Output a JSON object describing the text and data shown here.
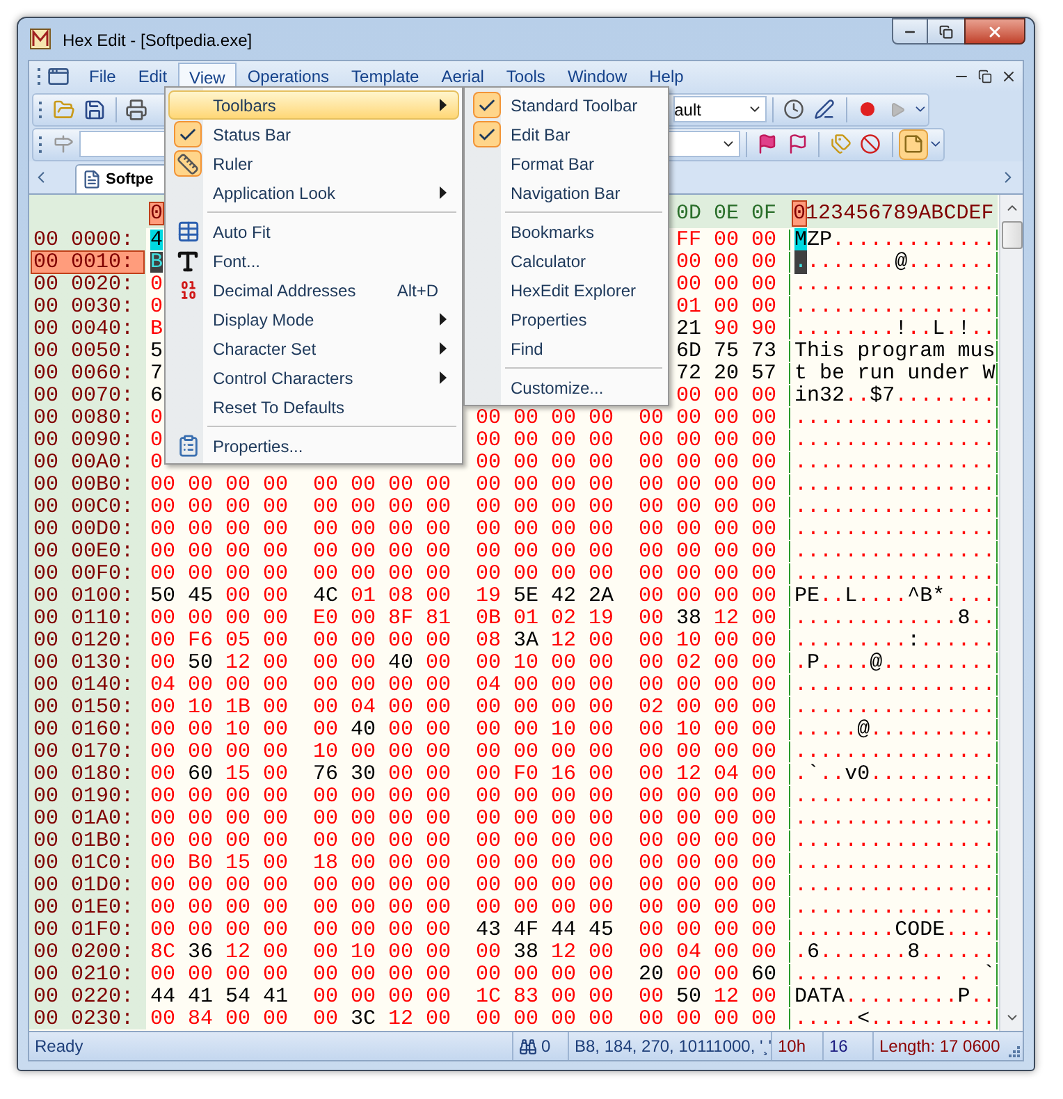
{
  "window": {
    "title": "Hex Edit - [Softpedia.exe]"
  },
  "menu_bar": [
    {
      "label": "File",
      "selected": false
    },
    {
      "label": "Edit",
      "selected": false
    },
    {
      "label": "View",
      "selected": true
    },
    {
      "label": "Operations",
      "selected": false
    },
    {
      "label": "Template",
      "selected": false
    },
    {
      "label": "Aerial",
      "selected": false
    },
    {
      "label": "Tools",
      "selected": false
    },
    {
      "label": "Window",
      "selected": false
    },
    {
      "label": "Help",
      "selected": false
    }
  ],
  "toolbar": {
    "combo_value": "ault"
  },
  "tabs": [
    {
      "label": "Softpe",
      "selected": true
    }
  ],
  "hex_view": {
    "header_lead": {
      "text": "0",
      "selected": true
    },
    "header_tail": [
      "0D",
      "0E",
      "0F"
    ],
    "text_header": "0123456789ABCDEF",
    "rows": [
      {
        "address": "00 0000:",
        "selected": false,
        "marked": true,
        "lead": "4",
        "lead_printable": true,
        "tail": [
          "FF",
          "00",
          "00"
        ],
        "text": "MZP............."
      },
      {
        "address": "00 0010:",
        "selected": true,
        "marked": false,
        "lead": "B",
        "lead_printable": false,
        "tail": [
          "00",
          "00",
          "00"
        ],
        "text": "........@......."
      },
      {
        "address": "00 0020:",
        "selected": false,
        "marked": false,
        "lead": "0",
        "lead_printable": false,
        "tail": [
          "00",
          "00",
          "00"
        ],
        "text": "................"
      },
      {
        "address": "00 0030:",
        "selected": false,
        "marked": false,
        "lead": "0",
        "lead_printable": false,
        "tail": [
          "01",
          "00",
          "00"
        ],
        "text": "................"
      },
      {
        "address": "00 0040:",
        "selected": false,
        "marked": false,
        "lead": "B",
        "lead_printable": false,
        "tail": [
          "21",
          "90",
          "90"
        ],
        "text": "........!..L.!.."
      },
      {
        "address": "00 0050:",
        "selected": false,
        "marked": false,
        "lead": "5",
        "lead_printable": true,
        "tail": [
          "6D",
          "75",
          "73"
        ],
        "text": "This program mus"
      },
      {
        "address": "00 0060:",
        "selected": false,
        "marked": false,
        "lead": "7",
        "lead_printable": true,
        "tail": [
          "72",
          "20",
          "57"
        ],
        "text": "t be run under W"
      },
      {
        "address": "00 0070:",
        "selected": false,
        "marked": false,
        "lead": "6",
        "lead_printable": true,
        "tail": [
          "00",
          "00",
          "00"
        ],
        "text": "in32..$7........"
      },
      {
        "address": "00 0080:",
        "selected": false,
        "marked": false,
        "lead": "0",
        "lead_printable": false,
        "tail": [
          "00",
          "00",
          "00",
          "00",
          "00",
          "00",
          "00",
          "00"
        ],
        "text": "................"
      },
      {
        "address": "00 0090:",
        "selected": false,
        "marked": false,
        "lead": "0",
        "lead_printable": false,
        "tail": [
          "00",
          "00",
          "00",
          "00",
          "00",
          "00",
          "00",
          "00"
        ],
        "text": "................"
      },
      {
        "address": "00 00A0:",
        "selected": false,
        "marked": false,
        "lead": "0",
        "lead_printable": false,
        "tail": [
          "00",
          "00",
          "00",
          "00",
          "00",
          "00",
          "00",
          "00"
        ],
        "text": "................"
      },
      {
        "address": "00 00B0:",
        "selected": false,
        "marked": false,
        "bytes": [
          "00",
          "00",
          "00",
          "00",
          "00",
          "00",
          "00",
          "00",
          "00",
          "00",
          "00",
          "00",
          "00",
          "00",
          "00",
          "00"
        ],
        "text": "................"
      },
      {
        "address": "00 00C0:",
        "selected": false,
        "marked": false,
        "bytes": [
          "00",
          "00",
          "00",
          "00",
          "00",
          "00",
          "00",
          "00",
          "00",
          "00",
          "00",
          "00",
          "00",
          "00",
          "00",
          "00"
        ],
        "text": "................"
      },
      {
        "address": "00 00D0:",
        "selected": false,
        "marked": false,
        "bytes": [
          "00",
          "00",
          "00",
          "00",
          "00",
          "00",
          "00",
          "00",
          "00",
          "00",
          "00",
          "00",
          "00",
          "00",
          "00",
          "00"
        ],
        "text": "................"
      },
      {
        "address": "00 00E0:",
        "selected": false,
        "marked": false,
        "bytes": [
          "00",
          "00",
          "00",
          "00",
          "00",
          "00",
          "00",
          "00",
          "00",
          "00",
          "00",
          "00",
          "00",
          "00",
          "00",
          "00"
        ],
        "text": "................"
      },
      {
        "address": "00 00F0:",
        "selected": false,
        "marked": false,
        "bytes": [
          "00",
          "00",
          "00",
          "00",
          "00",
          "00",
          "00",
          "00",
          "00",
          "00",
          "00",
          "00",
          "00",
          "00",
          "00",
          "00"
        ],
        "text": "................"
      },
      {
        "address": "00 0100:",
        "selected": false,
        "marked": false,
        "bytes": [
          "50",
          "45",
          "00",
          "00",
          "4C",
          "01",
          "08",
          "00",
          "19",
          "5E",
          "42",
          "2A",
          "00",
          "00",
          "00",
          "00"
        ],
        "text": "PE..L....^B*...."
      },
      {
        "address": "00 0110:",
        "selected": false,
        "marked": false,
        "bytes": [
          "00",
          "00",
          "00",
          "00",
          "E0",
          "00",
          "8F",
          "81",
          "0B",
          "01",
          "02",
          "19",
          "00",
          "38",
          "12",
          "00"
        ],
        "text": ".............8.."
      },
      {
        "address": "00 0120:",
        "selected": false,
        "marked": false,
        "bytes": [
          "00",
          "F6",
          "05",
          "00",
          "00",
          "00",
          "00",
          "00",
          "08",
          "3A",
          "12",
          "00",
          "00",
          "10",
          "00",
          "00"
        ],
        "text": ".........:......"
      },
      {
        "address": "00 0130:",
        "selected": false,
        "marked": false,
        "bytes": [
          "00",
          "50",
          "12",
          "00",
          "00",
          "00",
          "40",
          "00",
          "00",
          "10",
          "00",
          "00",
          "00",
          "02",
          "00",
          "00"
        ],
        "text": ".P....@........."
      },
      {
        "address": "00 0140:",
        "selected": false,
        "marked": false,
        "bytes": [
          "04",
          "00",
          "00",
          "00",
          "00",
          "00",
          "00",
          "00",
          "04",
          "00",
          "00",
          "00",
          "00",
          "00",
          "00",
          "00"
        ],
        "text": "................"
      },
      {
        "address": "00 0150:",
        "selected": false,
        "marked": false,
        "bytes": [
          "00",
          "10",
          "1B",
          "00",
          "00",
          "04",
          "00",
          "00",
          "00",
          "00",
          "00",
          "00",
          "02",
          "00",
          "00",
          "00"
        ],
        "text": "................"
      },
      {
        "address": "00 0160:",
        "selected": false,
        "marked": false,
        "bytes": [
          "00",
          "00",
          "10",
          "00",
          "00",
          "40",
          "00",
          "00",
          "00",
          "00",
          "10",
          "00",
          "00",
          "10",
          "00",
          "00"
        ],
        "text": ".....@.........."
      },
      {
        "address": "00 0170:",
        "selected": false,
        "marked": false,
        "bytes": [
          "00",
          "00",
          "00",
          "00",
          "10",
          "00",
          "00",
          "00",
          "00",
          "00",
          "00",
          "00",
          "00",
          "00",
          "00",
          "00"
        ],
        "text": "................"
      },
      {
        "address": "00 0180:",
        "selected": false,
        "marked": false,
        "bytes": [
          "00",
          "60",
          "15",
          "00",
          "76",
          "30",
          "00",
          "00",
          "00",
          "F0",
          "16",
          "00",
          "00",
          "12",
          "04",
          "00"
        ],
        "text": ".`..v0.........."
      },
      {
        "address": "00 0190:",
        "selected": false,
        "marked": false,
        "bytes": [
          "00",
          "00",
          "00",
          "00",
          "00",
          "00",
          "00",
          "00",
          "00",
          "00",
          "00",
          "00",
          "00",
          "00",
          "00",
          "00"
        ],
        "text": "................"
      },
      {
        "address": "00 01A0:",
        "selected": false,
        "marked": false,
        "bytes": [
          "00",
          "00",
          "00",
          "00",
          "00",
          "00",
          "00",
          "00",
          "00",
          "00",
          "00",
          "00",
          "00",
          "00",
          "00",
          "00"
        ],
        "text": "................"
      },
      {
        "address": "00 01B0:",
        "selected": false,
        "marked": false,
        "bytes": [
          "00",
          "00",
          "00",
          "00",
          "00",
          "00",
          "00",
          "00",
          "00",
          "00",
          "00",
          "00",
          "00",
          "00",
          "00",
          "00"
        ],
        "text": "................"
      },
      {
        "address": "00 01C0:",
        "selected": false,
        "marked": false,
        "bytes": [
          "00",
          "B0",
          "15",
          "00",
          "18",
          "00",
          "00",
          "00",
          "00",
          "00",
          "00",
          "00",
          "00",
          "00",
          "00",
          "00"
        ],
        "text": "................"
      },
      {
        "address": "00 01D0:",
        "selected": false,
        "marked": false,
        "bytes": [
          "00",
          "00",
          "00",
          "00",
          "00",
          "00",
          "00",
          "00",
          "00",
          "00",
          "00",
          "00",
          "00",
          "00",
          "00",
          "00"
        ],
        "text": "................"
      },
      {
        "address": "00 01E0:",
        "selected": false,
        "marked": false,
        "bytes": [
          "00",
          "00",
          "00",
          "00",
          "00",
          "00",
          "00",
          "00",
          "00",
          "00",
          "00",
          "00",
          "00",
          "00",
          "00",
          "00"
        ],
        "text": "................"
      },
      {
        "address": "00 01F0:",
        "selected": false,
        "marked": false,
        "bytes": [
          "00",
          "00",
          "00",
          "00",
          "00",
          "00",
          "00",
          "00",
          "43",
          "4F",
          "44",
          "45",
          "00",
          "00",
          "00",
          "00"
        ],
        "text": "........CODE...."
      },
      {
        "address": "00 0200:",
        "selected": false,
        "marked": false,
        "bytes": [
          "8C",
          "36",
          "12",
          "00",
          "00",
          "10",
          "00",
          "00",
          "00",
          "38",
          "12",
          "00",
          "00",
          "04",
          "00",
          "00"
        ],
        "text": ".6.......8......"
      },
      {
        "address": "00 0210:",
        "selected": false,
        "marked": false,
        "bytes": [
          "00",
          "00",
          "00",
          "00",
          "00",
          "00",
          "00",
          "00",
          "00",
          "00",
          "00",
          "00",
          "20",
          "00",
          "00",
          "60"
        ],
        "text": "............ ..`"
      },
      {
        "address": "00 0220:",
        "selected": false,
        "marked": false,
        "bytes": [
          "44",
          "41",
          "54",
          "41",
          "00",
          "00",
          "00",
          "00",
          "1C",
          "83",
          "00",
          "00",
          "00",
          "50",
          "12",
          "00"
        ],
        "text": "DATA.........P.."
      },
      {
        "address": "00 0230:",
        "selected": false,
        "marked": false,
        "bytes": [
          "00",
          "84",
          "00",
          "00",
          "00",
          "3C",
          "12",
          "00",
          "00",
          "00",
          "00",
          "00",
          "00",
          "00",
          "00",
          "00"
        ],
        "text": ".....<.........."
      }
    ]
  },
  "view_menu": {
    "items": [
      {
        "kind": "submenu",
        "label": "Toolbars",
        "checked": false,
        "selected": true
      },
      {
        "kind": "item",
        "label": "Status Bar",
        "checked": true,
        "selected": false
      },
      {
        "kind": "item",
        "label": "Ruler",
        "checked": true,
        "selected": false
      },
      {
        "kind": "submenu",
        "label": "Application Look",
        "checked": false,
        "selected": false
      },
      {
        "kind": "separator"
      },
      {
        "kind": "item",
        "label": "Auto Fit",
        "checked": false,
        "selected": false
      },
      {
        "kind": "item",
        "label": "Font...",
        "checked": false,
        "selected": false
      },
      {
        "kind": "item",
        "label": "Decimal Addresses",
        "shortcut": "Alt+D",
        "checked": false,
        "selected": false
      },
      {
        "kind": "submenu",
        "label": "Display Mode",
        "checked": false,
        "selected": false
      },
      {
        "kind": "submenu",
        "label": "Character Set",
        "checked": false,
        "selected": false
      },
      {
        "kind": "submenu",
        "label": "Control Characters",
        "checked": false,
        "selected": false
      },
      {
        "kind": "item",
        "label": "Reset To Defaults",
        "checked": false,
        "selected": false
      },
      {
        "kind": "separator"
      },
      {
        "kind": "item",
        "label": "Properties...",
        "checked": false,
        "selected": false
      }
    ]
  },
  "toolbars_submenu": {
    "items": [
      {
        "kind": "item",
        "label": "Standard Toolbar",
        "checked": true,
        "selected": false
      },
      {
        "kind": "item",
        "label": "Edit Bar",
        "checked": true,
        "selected": false
      },
      {
        "kind": "item",
        "label": "Format Bar",
        "checked": false,
        "selected": false
      },
      {
        "kind": "item",
        "label": "Navigation Bar",
        "checked": false,
        "selected": false
      },
      {
        "kind": "separator"
      },
      {
        "kind": "item",
        "label": "Bookmarks",
        "checked": false,
        "selected": false
      },
      {
        "kind": "item",
        "label": "Calculator",
        "checked": false,
        "selected": false
      },
      {
        "kind": "item",
        "label": "HexEdit Explorer",
        "checked": false,
        "selected": false
      },
      {
        "kind": "item",
        "label": "Properties",
        "checked": false,
        "selected": false
      },
      {
        "kind": "item",
        "label": "Find",
        "checked": false,
        "selected": false
      },
      {
        "kind": "separator"
      },
      {
        "kind": "item",
        "label": "Customize...",
        "checked": false,
        "selected": false
      }
    ]
  },
  "status_bar": {
    "message": "Ready",
    "find_count": "0",
    "value_info": "B8, 184, 270, 10111000, '¸'",
    "offset": "10h",
    "columns": "16",
    "length": "Length: 17 0600"
  }
}
